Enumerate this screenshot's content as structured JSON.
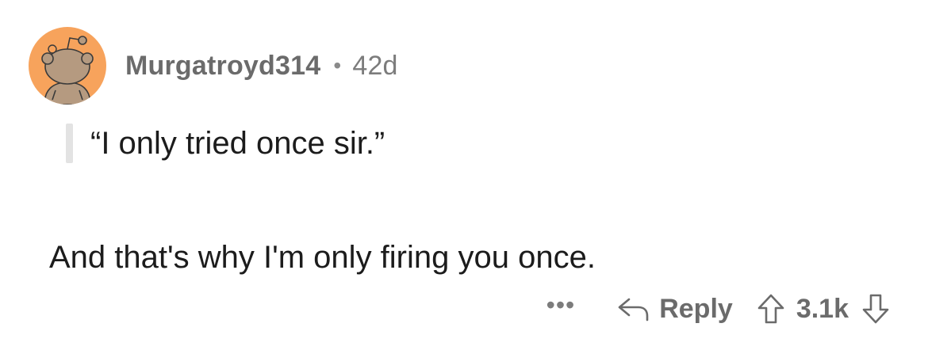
{
  "comment": {
    "username": "Murgatroyd314",
    "separator": "•",
    "age": "42d",
    "quote": "“I only tried once sir.”",
    "body": "And that's why I'm only firing you once.",
    "actions": {
      "more": "•••",
      "reply_label": "Reply",
      "score": "3.1k"
    },
    "avatar": {
      "icon": "snoo-avatar-icon",
      "background_color": "#f7a35c",
      "figure_color": "#b59a80"
    }
  }
}
